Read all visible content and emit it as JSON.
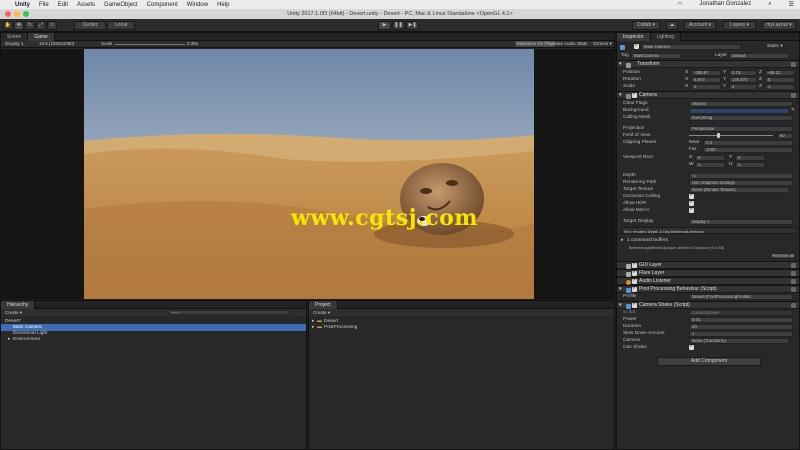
{
  "macos_menu": [
    "Unity",
    "File",
    "Edit",
    "Assets",
    "GameObject",
    "Component",
    "Window",
    "Help"
  ],
  "window_title": "Unity 2017.1.0f3 (64bit) - Desert.unity - Desert - PC, Mac & Linux Standalone <OpenGL 4.1>",
  "toolbar": {
    "center_label": "Center",
    "local_label": "Local",
    "collab_label": "Collab ▾",
    "account_label": "Account ▾",
    "layers_label": "Layers ▾",
    "layout_label": "myLayout ▾",
    "user_name": "Jonathan Gonzalez"
  },
  "scene_tabs": [
    "Scene",
    "Game"
  ],
  "game_view": {
    "display": "Display 1",
    "resolution": "16:9 (1920x1080)",
    "scale_label": "Scale",
    "scale_value": "0.39x",
    "toggles": [
      "Maximize On Play",
      "Mute Audio",
      "Stats",
      "Gizmos ▾"
    ]
  },
  "watermark": "www.cgtsj.com",
  "hierarchy": {
    "tab": "Hierarchy",
    "create": "Create ▾",
    "search_placeholder": "Q▾All",
    "scene": "Desert*",
    "items": [
      "Main Camera",
      "Directional Light",
      "Environment"
    ]
  },
  "project": {
    "tab": "Project",
    "create": "Create ▾",
    "folders": [
      "Desert",
      "PostProcessing"
    ]
  },
  "inspector": {
    "tabs": [
      "Inspector",
      "Lighting"
    ],
    "object_name": "Main Camera",
    "static_label": "Static ▾",
    "tag_label": "Tag",
    "tag_value": "MainCamera",
    "layer_label": "Layer",
    "layer_value": "Default",
    "transform": {
      "title": "Transform",
      "position": {
        "label": "Position",
        "x": "-388.67",
        "y": "0.75",
        "z": "-69.12"
      },
      "rotation": {
        "label": "Rotation",
        "x": "6.974",
        "y": "176.872",
        "z": "0"
      },
      "scale": {
        "label": "Scale",
        "x": "1",
        "y": "1",
        "z": "1"
      }
    },
    "camera": {
      "title": "Camera",
      "clear_flags": {
        "label": "Clear Flags",
        "value": "Skybox"
      },
      "background": {
        "label": "Background"
      },
      "culling_mask": {
        "label": "Culling Mask",
        "value": "Everything"
      },
      "projection": {
        "label": "Projection",
        "value": "Perspective"
      },
      "fov": {
        "label": "Field of View",
        "value": "60"
      },
      "clipping": {
        "label": "Clipping Planes",
        "near_label": "Near",
        "near": "0.3",
        "far_label": "Far",
        "far": "1000"
      },
      "viewport": {
        "label": "Viewport Rect",
        "x": "0",
        "y": "0",
        "w": "1",
        "h": "1"
      },
      "depth": {
        "label": "Depth",
        "value": "-1"
      },
      "rendering_path": {
        "label": "Rendering Path",
        "value": "Use Graphics Settings"
      },
      "target_texture": {
        "label": "Target Texture",
        "value": "None (Render Texture)"
      },
      "occlusion": {
        "label": "Occlusion Culling"
      },
      "hdr": {
        "label": "Allow HDR"
      },
      "msaa": {
        "label": "Allow MSAA"
      },
      "target_display": {
        "label": "Target Display",
        "value": "Display 1"
      },
      "info": "Info: renders Depth & DepthNormals textures",
      "buffers": "1 command buffers",
      "buffer_item": "BeforeImageEffectsOpaque: Ambient Occlusion (0.0 KB)",
      "remove_all": "Remove all"
    },
    "components": [
      "GUI Layer",
      "Flare Layer",
      "Audio Listener",
      "Post Processing Behaviour (Script)"
    ],
    "profile": {
      "label": "Profile",
      "value": "Desert (PostProcessingProfile)"
    },
    "camera_shake": {
      "title": "Camera Shake (Script)",
      "script": {
        "label": "Script",
        "value": "CameraShake"
      },
      "power": {
        "label": "Power",
        "value": "0.01"
      },
      "duration": {
        "label": "Duration",
        "value": "20"
      },
      "slowdown": {
        "label": "Slow Down Amount",
        "value": "1"
      },
      "camera": {
        "label": "Camera",
        "value": "None (Transform)"
      },
      "can_shake": {
        "label": "Can Shake"
      }
    },
    "add_component": "Add Component"
  },
  "colors": {
    "editor_bg": "#282828",
    "accent": "#3d6eb5",
    "watermark": "#f7e600",
    "camera_bg": "#31446b"
  }
}
